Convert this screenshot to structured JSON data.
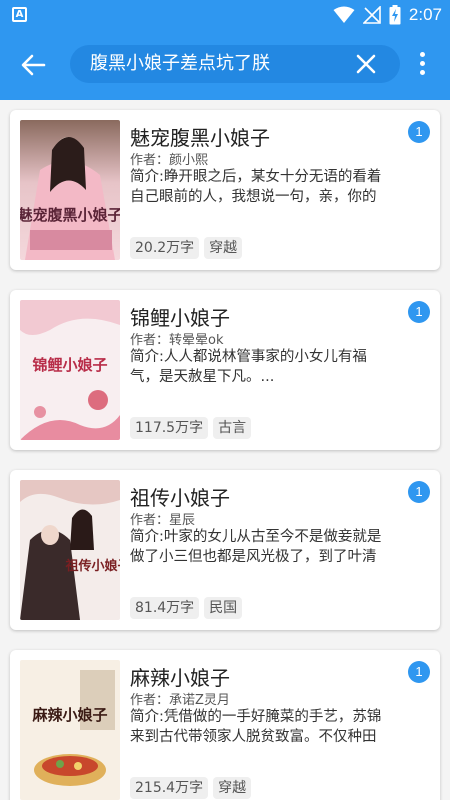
{
  "status_bar": {
    "app_icon_letter": "A",
    "time": "2:07"
  },
  "toolbar": {
    "search_query": "腹黑小娘子差点坑了朕"
  },
  "colors": {
    "primary": "#2f97f0",
    "search_box": "#2388e2",
    "badge": "#2f97f0",
    "tag_bg": "#efefef"
  },
  "results": [
    {
      "title": "魅宠腹黑小娘子",
      "author": "作者：颜小熙",
      "intro": "简介:睁开眼之后，某女十分无语的看着自己眼前的人，我想说一句，亲，你的",
      "word_count": "20.2万字",
      "genre": "穿越",
      "badge": "1",
      "cover_text": "魅宠腹黑小娘子"
    },
    {
      "title": "锦鲤小娘子",
      "author": "作者：转晕晕ok",
      "intro": "简介:人人都说林管事家的小女儿有福气，是天赦星下凡。...",
      "word_count": "117.5万字",
      "genre": "古言",
      "badge": "1",
      "cover_text": "锦鲤小娘子"
    },
    {
      "title": "祖传小娘子",
      "author": "作者：星辰",
      "intro": "简介:叶家的女儿从古至今不是做妾就是做了小三但也都是风光极了，到了叶清",
      "word_count": "81.4万字",
      "genre": "民国",
      "badge": "1",
      "cover_text": "祖传小娘子"
    },
    {
      "title": "麻辣小娘子",
      "author": "作者：承诺Z灵月",
      "intro": "简介:凭借做的一手好腌菜的手艺，苏锦来到古代带领家人脱贫致富。不仅种田",
      "word_count": "215.4万字",
      "genre": "穿越",
      "badge": "1",
      "cover_text": "麻辣小娘子"
    }
  ]
}
